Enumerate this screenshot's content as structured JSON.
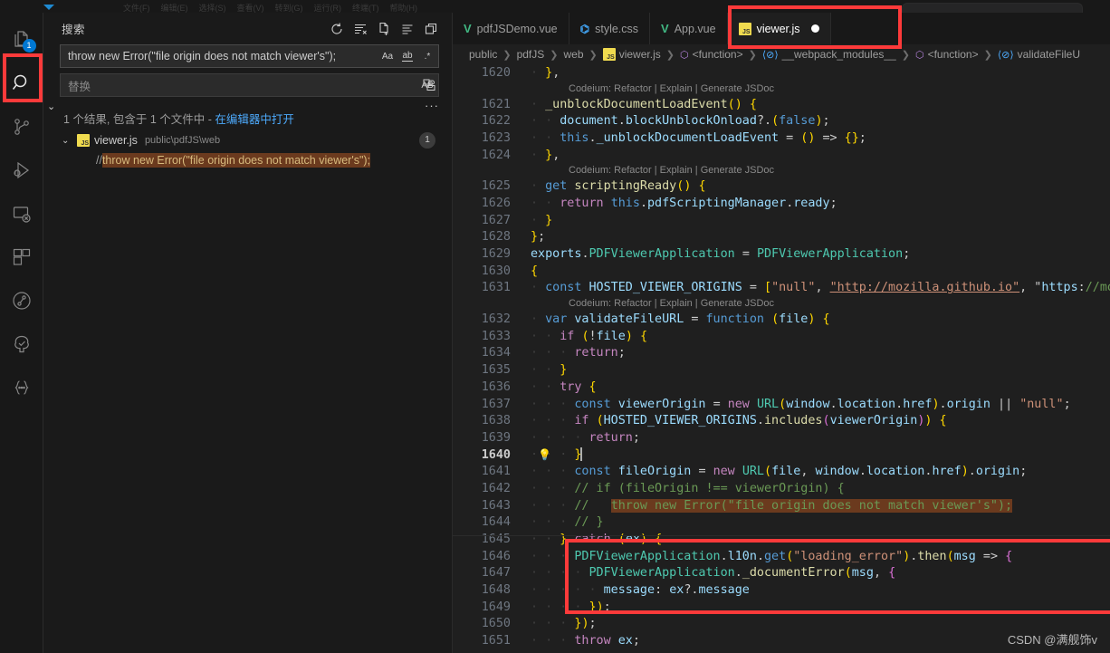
{
  "window": {
    "menu_items": [
      "文件(F)",
      "编辑(E)",
      "选择(S)",
      "查看(V)",
      "转到(G)",
      "运行(R)",
      "终端(T)",
      "帮助(H)"
    ]
  },
  "activitybar": {
    "items": [
      {
        "name": "explorer",
        "icon": "files-icon",
        "badge": "1"
      },
      {
        "name": "search",
        "icon": "search-icon",
        "badge": ""
      },
      {
        "name": "source-control",
        "icon": "source-control-icon",
        "badge": ""
      },
      {
        "name": "run-and-debug",
        "icon": "run-debug-icon",
        "badge": ""
      },
      {
        "name": "remote-explorer",
        "icon": "remote-icon",
        "badge": ""
      },
      {
        "name": "extensions",
        "icon": "extensions-icon",
        "badge": ""
      },
      {
        "name": "gitlens",
        "icon": "gitlens-icon",
        "badge": ""
      },
      {
        "name": "testing",
        "icon": "testing-tree-icon",
        "badge": ""
      },
      {
        "name": "json-outline",
        "icon": "braces-icon",
        "badge": ""
      }
    ],
    "check_glyph": "✓"
  },
  "sidebar": {
    "title": "搜索",
    "actions": [
      {
        "name": "refresh",
        "label": "刷新"
      },
      {
        "name": "clear-search-results",
        "label": "清除搜索结果"
      },
      {
        "name": "open-new-search-editor",
        "label": "在编辑器中打开新搜索"
      },
      {
        "name": "view-as-list",
        "label": "以列表形式查看"
      },
      {
        "name": "collapse-all",
        "label": "全部折叠"
      }
    ],
    "search": {
      "value": "throw new Error(\"file origin does not match viewer's\");",
      "placeholder": "搜索",
      "options": [
        {
          "name": "match-case",
          "glyph": "Aa"
        },
        {
          "name": "match-whole-word",
          "glyph": "ab"
        },
        {
          "name": "use-regex",
          "glyph": ".*"
        }
      ]
    },
    "replace": {
      "value": "",
      "placeholder": "替换",
      "preserve_case_glyph": "AB",
      "replace_all_label": "全部替换"
    },
    "toggle_details_glyph": "···",
    "summary_text": "1 个结果, 包含于 1 个文件中 - ",
    "summary_link": "在编辑器中打开",
    "results": [
      {
        "file_name": "viewer.js",
        "file_path": "public\\pdfJS\\web",
        "file_icon": "js-file-icon",
        "count": "1",
        "matches": [
          {
            "prefix": "// ",
            "match": "throw new Error(\"file origin does not match viewer's\");"
          }
        ]
      }
    ]
  },
  "editor": {
    "tabs": [
      {
        "label": "pdfJSDemo.vue",
        "icon": "vue-file-icon",
        "active": false,
        "dirty": false
      },
      {
        "label": "style.css",
        "icon": "css-file-icon",
        "active": false,
        "dirty": false
      },
      {
        "label": "App.vue",
        "icon": "vue-file-icon",
        "active": false,
        "dirty": false
      },
      {
        "label": "viewer.js",
        "icon": "js-file-icon",
        "active": true,
        "dirty": true
      }
    ],
    "breadcrumb": [
      {
        "text": "public",
        "symbol": ""
      },
      {
        "text": "pdfJS",
        "symbol": ""
      },
      {
        "text": "web",
        "symbol": ""
      },
      {
        "text": "viewer.js",
        "symbol": "js-file-icon"
      },
      {
        "text": "<function>",
        "symbol": "symbol-namespace-icon"
      },
      {
        "text": "__webpack_modules__",
        "symbol": "symbol-variable-icon"
      },
      {
        "text": "<function>",
        "symbol": "symbol-namespace-icon"
      },
      {
        "text": "validateFileU",
        "symbol": "symbol-variable-icon"
      }
    ],
    "current_line": 1640,
    "codelens_label": "Codeium: Refactor | Explain | Generate JSDoc",
    "first_line_number": 1620,
    "lines": [
      {
        "n": 1620,
        "indent": 2,
        "text": "},"
      },
      {
        "n": 1621,
        "indent": 2,
        "text": "_unblockDocumentLoadEvent() {",
        "codelens_above": true
      },
      {
        "n": 1622,
        "indent": 4,
        "text": "document.blockUnblockOnload?.(false);"
      },
      {
        "n": 1623,
        "indent": 4,
        "text": "this._unblockDocumentLoadEvent = () => {};"
      },
      {
        "n": 1624,
        "indent": 2,
        "text": "},"
      },
      {
        "n": 1625,
        "indent": 2,
        "text": "get scriptingReady() {",
        "codelens_above": true
      },
      {
        "n": 1626,
        "indent": 4,
        "text": "return this.pdfScriptingManager.ready;"
      },
      {
        "n": 1627,
        "indent": 2,
        "text": "}"
      },
      {
        "n": 1628,
        "indent": 0,
        "text": "};"
      },
      {
        "n": 1629,
        "indent": 0,
        "text": "exports.PDFViewerApplication = PDFViewerApplication;"
      },
      {
        "n": 1630,
        "indent": 0,
        "text": "{"
      },
      {
        "n": 1631,
        "indent": 2,
        "text": "const HOSTED_VIEWER_ORIGINS = [\"null\", \"http://mozilla.github.io\", \"https://mozilla."
      },
      {
        "n": 1632,
        "indent": 2,
        "text": "var validateFileURL = function (file) {",
        "codelens_above": true
      },
      {
        "n": 1633,
        "indent": 4,
        "text": "if (!file) {"
      },
      {
        "n": 1634,
        "indent": 6,
        "text": "return;"
      },
      {
        "n": 1635,
        "indent": 4,
        "text": "}"
      },
      {
        "n": 1636,
        "indent": 4,
        "text": "try {"
      },
      {
        "n": 1637,
        "indent": 6,
        "text": "const viewerOrigin = new URL(window.location.href).origin || \"null\";"
      },
      {
        "n": 1638,
        "indent": 6,
        "text": "if (HOSTED_VIEWER_ORIGINS.includes(viewerOrigin)) {"
      },
      {
        "n": 1639,
        "indent": 8,
        "text": "return;"
      },
      {
        "n": 1640,
        "indent": 6,
        "text": "}"
      },
      {
        "n": 1641,
        "indent": 6,
        "text": "const fileOrigin = new URL(file, window.location.href).origin;"
      },
      {
        "n": 1642,
        "indent": 6,
        "text": "// if (fileOrigin !== viewerOrigin) {"
      },
      {
        "n": 1643,
        "indent": 6,
        "text": "//   throw new Error(\"file origin does not match viewer's\");"
      },
      {
        "n": 1644,
        "indent": 6,
        "text": "// }"
      },
      {
        "n": 1645,
        "indent": 4,
        "text": "} catch (ex) {"
      },
      {
        "n": 1646,
        "indent": 6,
        "text": "PDFViewerApplication.l10n.get(\"loading_error\").then(msg => {"
      },
      {
        "n": 1647,
        "indent": 8,
        "text": "PDFViewerApplication._documentError(msg, {"
      },
      {
        "n": 1648,
        "indent": 10,
        "text": "message: ex?.message"
      },
      {
        "n": 1649,
        "indent": 8,
        "text": "});"
      },
      {
        "n": 1650,
        "indent": 6,
        "text": "});"
      },
      {
        "n": 1651,
        "indent": 6,
        "text": "throw ex;"
      }
    ]
  },
  "annotations": {
    "highlight_color": "#fc3a3a",
    "boxes": [
      {
        "name": "search-activity-icon-box"
      },
      {
        "name": "viewer-js-tab-box"
      },
      {
        "name": "commented-code-box"
      }
    ]
  },
  "watermark": {
    "text": "CSDN @满舰饰v"
  }
}
